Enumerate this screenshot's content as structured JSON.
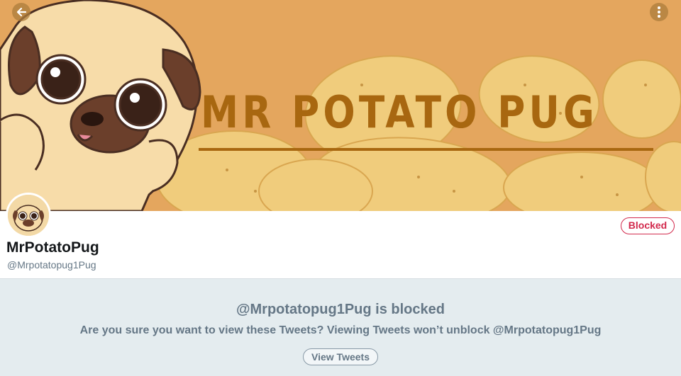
{
  "banner": {
    "title": "MR POTATO PUG",
    "colors": {
      "background": "#e4a65e",
      "title": "#a86710",
      "potato": "#f0cc7c"
    }
  },
  "toolbar": {
    "back_icon": "arrow-left-icon",
    "menu_icon": "more-vertical-icon"
  },
  "profile": {
    "display_name": "MrPotatoPug",
    "handle": "@Mrpotatopug1Pug",
    "blocked_label": "Blocked",
    "accent": "#d2294c"
  },
  "notice": {
    "title": "@Mrpotatopug1Pug is blocked",
    "text": "Are you sure you want to view these Tweets? Viewing Tweets won’t unblock @Mrpotatopug1Pug",
    "button_label": "View Tweets"
  }
}
